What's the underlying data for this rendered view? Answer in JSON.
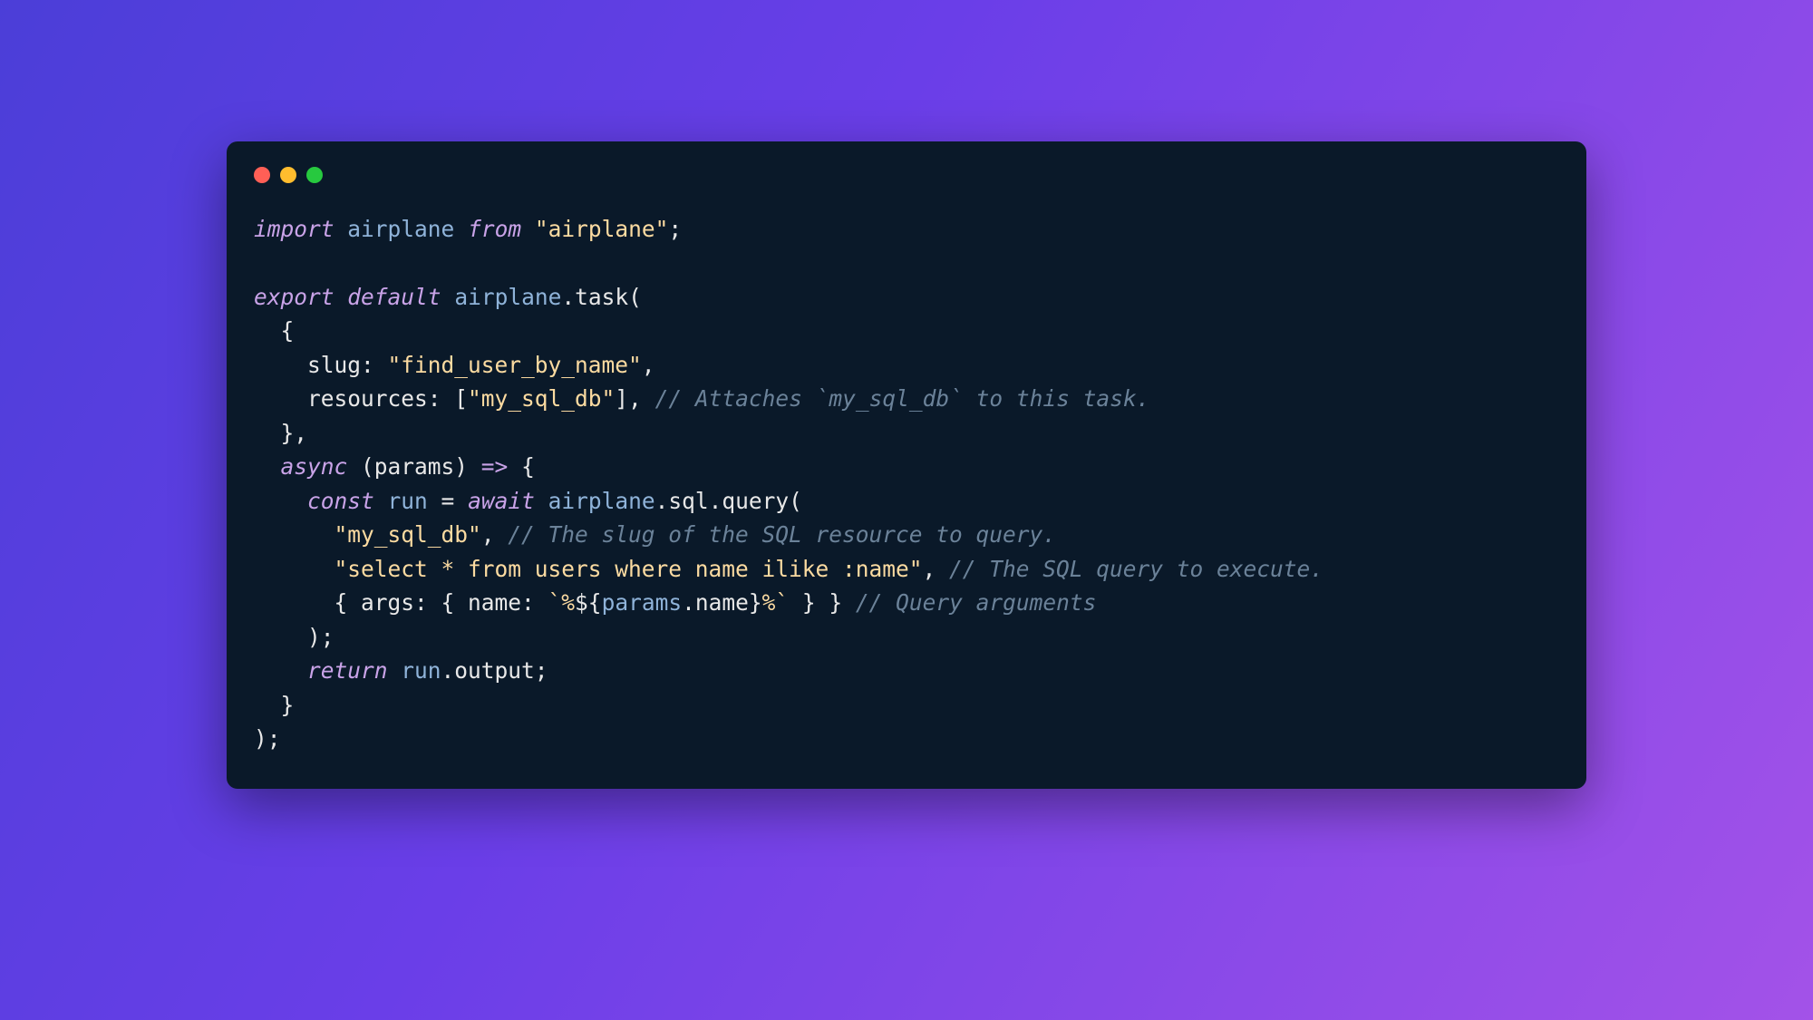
{
  "window": {
    "traffic_lights": [
      "red",
      "yellow",
      "green"
    ]
  },
  "code": {
    "line1": {
      "kw_import": "import",
      "ident_airplane": "airplane",
      "kw_from": "from",
      "str_module": "\"airplane\"",
      "semi": ";"
    },
    "line2": "",
    "line3": {
      "kw_export": "export",
      "kw_default": "default",
      "ident_airplane": "airplane",
      "method": ".task(",
      "close": ""
    },
    "line4": {
      "indent": "  ",
      "brace": "{"
    },
    "line5": {
      "indent": "    ",
      "prop": "slug: ",
      "str": "\"find_user_by_name\"",
      "comma": ","
    },
    "line6": {
      "indent": "    ",
      "prop": "resources: [",
      "str": "\"my_sql_db\"",
      "close": "], ",
      "comment": "// Attaches `my_sql_db` to this task."
    },
    "line7": {
      "indent": "  ",
      "brace": "},"
    },
    "line8": {
      "indent": "  ",
      "kw_async": "async",
      "params": " (params) ",
      "arrow": "=>",
      "brace": " {"
    },
    "line9": {
      "indent": "    ",
      "kw_const": "const",
      "ident_run": " run ",
      "eq": "= ",
      "kw_await": "await",
      "call": " airplane",
      "method": ".sql.query("
    },
    "line10": {
      "indent": "      ",
      "str": "\"my_sql_db\"",
      "comma": ", ",
      "comment": "// The slug of the SQL resource to query."
    },
    "line11": {
      "indent": "      ",
      "str": "\"select * from users where name ilike :name\"",
      "comma": ", ",
      "comment": "// The SQL query to execute."
    },
    "line12": {
      "indent": "      ",
      "open": "{ args: { name: ",
      "backtick1": "`%",
      "interp_open": "${",
      "ident_params": "params",
      "dot_name": ".name",
      "interp_close": "}",
      "backtick2": "%`",
      "close": " } } ",
      "comment": "// Query arguments"
    },
    "line13": {
      "indent": "    ",
      "close": ");"
    },
    "line14": {
      "indent": "    ",
      "kw_return": "return",
      "ident_run": " run",
      "dot_output": ".output;"
    },
    "line15": {
      "indent": "  ",
      "brace": "}"
    },
    "line16": {
      "close": ");"
    }
  }
}
